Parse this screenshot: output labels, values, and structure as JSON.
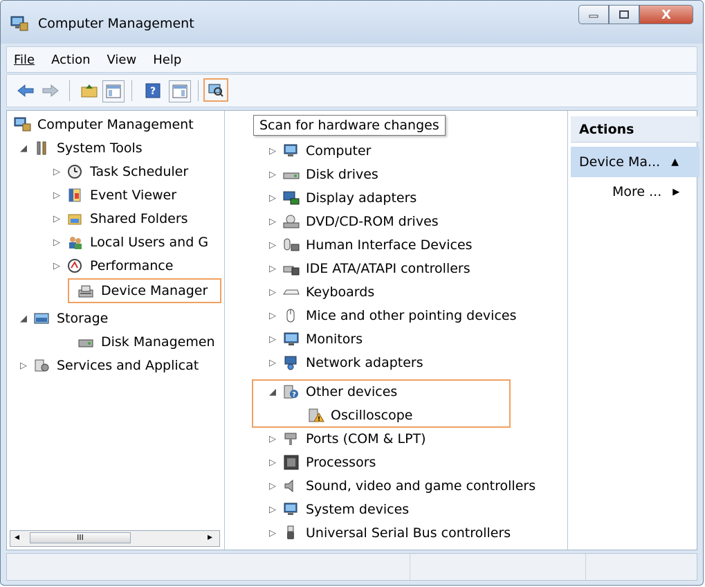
{
  "window": {
    "title": "Computer Management",
    "minimize_glyph": "▭",
    "maximize_glyph": "□",
    "close_glyph": "X"
  },
  "menu": [
    "File",
    "Action",
    "View",
    "Help"
  ],
  "toolbar": {
    "items": [
      "back-arrow-icon",
      "forward-arrow-icon",
      "up-folder-icon",
      "show-hide-console-tree-icon",
      "help-icon",
      "show-hide-action-pane-icon",
      "scan-hardware-icon"
    ],
    "tooltip": "Scan for hardware changes"
  },
  "left_tree": [
    {
      "label": "Computer Management",
      "expander": "",
      "icon": "computer-management-icon"
    },
    {
      "label": "System Tools",
      "expander": "◢",
      "icon": "tools-icon"
    },
    {
      "label": "Task Scheduler",
      "expander": "▷",
      "icon": "clock-icon"
    },
    {
      "label": "Event Viewer",
      "expander": "▷",
      "icon": "event-viewer-icon"
    },
    {
      "label": "Shared Folders",
      "expander": "▷",
      "icon": "shared-folder-icon"
    },
    {
      "label": "Local Users and G",
      "expander": "▷",
      "icon": "users-icon"
    },
    {
      "label": "Performance",
      "expander": "▷",
      "icon": "performance-icon"
    },
    {
      "label": "Device Manager",
      "expander": "",
      "icon": "device-manager-icon"
    },
    {
      "label": "Storage",
      "expander": "◢",
      "icon": "storage-icon"
    },
    {
      "label": "Disk Managemen",
      "expander": "",
      "icon": "disk-icon"
    },
    {
      "label": "Services and Applicat",
      "expander": "▷",
      "icon": "services-icon"
    }
  ],
  "scrollbar": {
    "grip": "III",
    "left": "◂",
    "right": "▸"
  },
  "devices": [
    {
      "label": "Computer",
      "expander": "▷",
      "icon": "computer-icon"
    },
    {
      "label": "Disk drives",
      "expander": "▷",
      "icon": "disk-drive-icon"
    },
    {
      "label": "Display adapters",
      "expander": "▷",
      "icon": "display-adapter-icon"
    },
    {
      "label": "DVD/CD-ROM drives",
      "expander": "▷",
      "icon": "dvd-icon"
    },
    {
      "label": "Human Interface Devices",
      "expander": "▷",
      "icon": "hid-icon"
    },
    {
      "label": "IDE ATA/ATAPI controllers",
      "expander": "▷",
      "icon": "ide-controller-icon"
    },
    {
      "label": "Keyboards",
      "expander": "▷",
      "icon": "keyboard-icon"
    },
    {
      "label": "Mice and other pointing devices",
      "expander": "▷",
      "icon": "mouse-icon"
    },
    {
      "label": "Monitors",
      "expander": "▷",
      "icon": "monitor-icon"
    },
    {
      "label": "Network adapters",
      "expander": "▷",
      "icon": "network-adapter-icon"
    },
    {
      "label": "Other devices",
      "expander": "◢",
      "icon": "unknown-device-icon"
    },
    {
      "label": "Oscilloscope",
      "expander": "",
      "icon": "warning-device-icon"
    },
    {
      "label": "Ports (COM & LPT)",
      "expander": "▷",
      "icon": "port-icon"
    },
    {
      "label": "Processors",
      "expander": "▷",
      "icon": "processor-icon"
    },
    {
      "label": "Sound, video and game controllers",
      "expander": "▷",
      "icon": "sound-icon"
    },
    {
      "label": "System devices",
      "expander": "▷",
      "icon": "system-devices-icon"
    },
    {
      "label": "Universal Serial Bus controllers",
      "expander": "▷",
      "icon": "usb-icon"
    }
  ],
  "actions": {
    "header": "Actions",
    "device_manager": "Device Ma...",
    "collapse_glyph": "▲",
    "more": "More ...",
    "more_glyph": "▶"
  },
  "colors": {
    "highlight_border": "#f0a060",
    "selection_bg": "#c8dcf2",
    "title_gradient": "#c9d9ec"
  }
}
